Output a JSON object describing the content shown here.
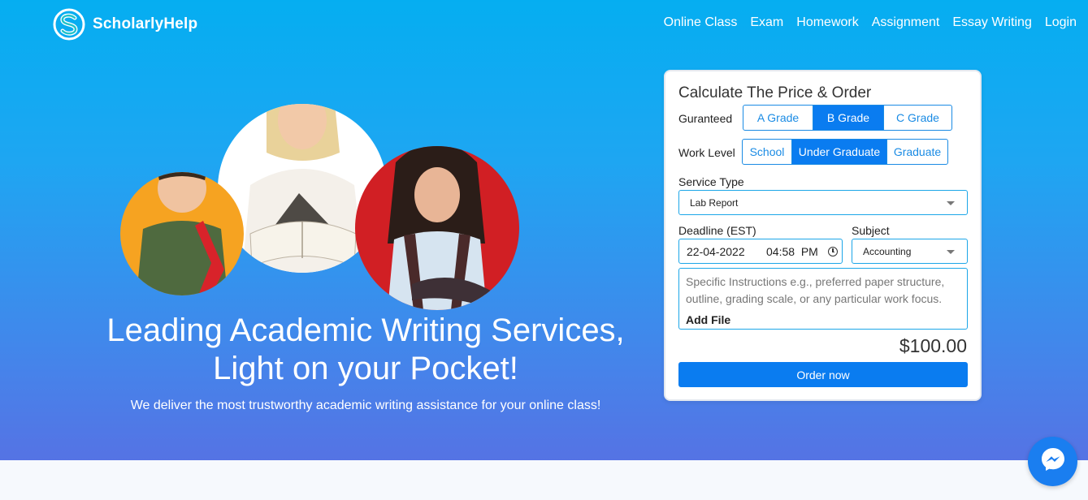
{
  "brand": {
    "name": "ScholarlyHelp",
    "logo_icon": "scholarlyhelp-s-logo"
  },
  "nav": [
    {
      "label": "Online Class"
    },
    {
      "label": "Exam"
    },
    {
      "label": "Homework"
    },
    {
      "label": "Assignment"
    },
    {
      "label": "Essay Writing"
    },
    {
      "label": "Login"
    }
  ],
  "hero": {
    "headline_line1": "Leading Academic Writing Services,",
    "headline_line2": "Light on your Pocket!",
    "subheadline": "We deliver the most trustworthy academic writing assistance for your online class!"
  },
  "calculator": {
    "title": "Calculate The Price & Order",
    "guaranteed_label": "Guranteed",
    "grades": [
      {
        "label": "A Grade",
        "active": false
      },
      {
        "label": "B Grade",
        "active": true
      },
      {
        "label": "C Grade",
        "active": false
      }
    ],
    "work_level_label": "Work Level",
    "work_levels": [
      {
        "label": "School",
        "active": false
      },
      {
        "label": "Under Graduate",
        "active": true
      },
      {
        "label": "Graduate",
        "active": false
      }
    ],
    "service_type_label": "Service Type",
    "service_type_value": "Lab Report",
    "deadline_label": "Deadline (EST)",
    "deadline_date": "22-04-2022",
    "deadline_time": "04:58  PM",
    "subject_label": "Subject",
    "subject_value": "Accounting",
    "instructions_placeholder": "Specific Instructions e.g., preferred paper structure, outline, grading scale, or any particular work focus.",
    "add_file_label": "Add File",
    "price": "$100.00",
    "order_button": "Order now"
  },
  "colors": {
    "accent": "#0a7cf0",
    "border": "#1ca6e8",
    "hero_top": "#05aef1",
    "hero_bottom": "#5573e4"
  },
  "chat_widget": {
    "icon": "messenger-icon"
  }
}
